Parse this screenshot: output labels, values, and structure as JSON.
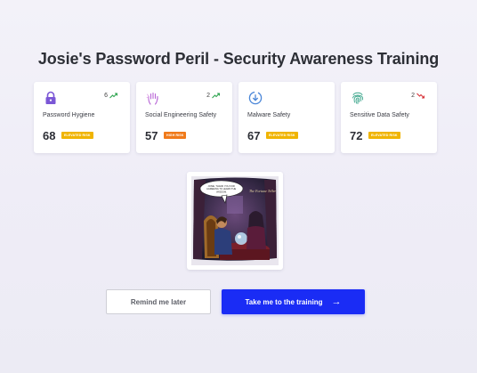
{
  "page": {
    "title": "Josie's Password Peril - Security Awareness Training"
  },
  "cards": [
    {
      "label": "Password Hygiene",
      "score": "68",
      "badge": "ELEVATED RISK",
      "badge_color": "#f0b400",
      "trend_value": "6",
      "trend_direction": "up",
      "icon": "padlock-icon",
      "icon_color": "#7b57d6"
    },
    {
      "label": "Social Engineering Safety",
      "score": "57",
      "badge": "HIGH RISK",
      "badge_color": "#f07a1a",
      "trend_value": "2",
      "trend_direction": "up",
      "icon": "hand-icon",
      "icon_color": "#b765d6"
    },
    {
      "label": "Malware Safety",
      "score": "67",
      "badge": "ELEVATED RISK",
      "badge_color": "#f0b400",
      "trend_value": "",
      "trend_direction": "none",
      "icon": "download-icon",
      "icon_color": "#4a86d8"
    },
    {
      "label": "Sensitive Data Safety",
      "score": "72",
      "badge": "ELEVATED RISK",
      "badge_color": "#f0b400",
      "trend_value": "2",
      "trend_direction": "down",
      "icon": "fingerprint-icon",
      "icon_color": "#3aa58a"
    }
  ],
  "comic": {
    "speech": "JOSIE, THANK YOU FOR AGREEING TO LEARN THE WISDOM.",
    "sign": "The Fortune Teller"
  },
  "buttons": {
    "later_label": "Remind me later",
    "training_label": "Take me to the training",
    "training_arrow": "→",
    "primary_color": "#1a2cf5"
  },
  "colors": {
    "trend_up": "#2ea44f",
    "trend_down": "#d8343a"
  }
}
